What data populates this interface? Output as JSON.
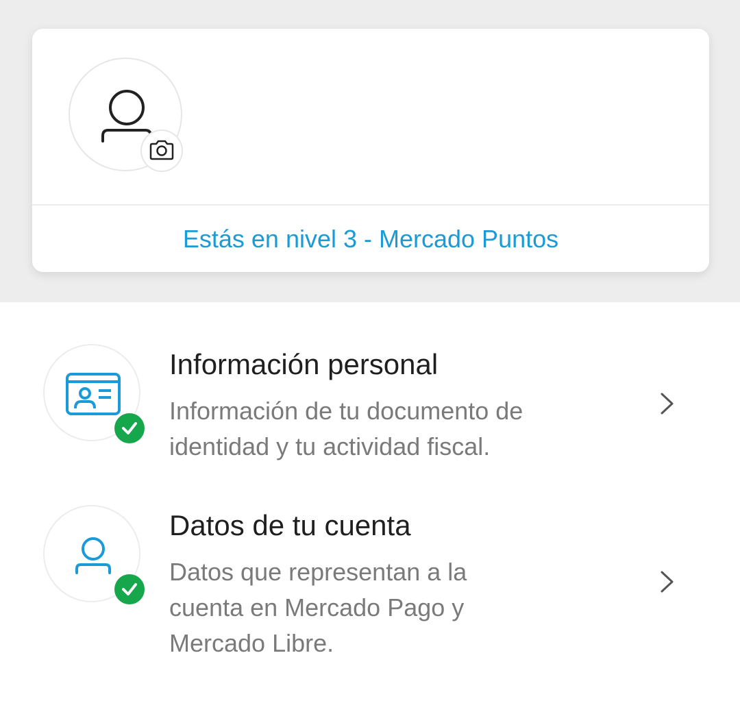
{
  "profile": {
    "level_link": "Estás en nivel 3 - Mercado Puntos",
    "avatar_icon": "person-icon",
    "camera_icon": "camera-icon"
  },
  "rows": [
    {
      "title": "Información personal",
      "description": "Información de tu documento de identidad y tu actividad fiscal.",
      "icon": "id-card-icon",
      "status_icon": "check-icon",
      "chevron": "chevron-right-icon"
    },
    {
      "title": "Datos de tu cuenta",
      "description": "Datos que representan a la cuenta en Mercado Pago y Mercado Libre.",
      "icon": "user-icon",
      "status_icon": "check-icon",
      "chevron": "chevron-right-icon"
    }
  ],
  "colors": {
    "accent": "#1a9ad6",
    "success": "#16a64b",
    "background_top": "#ededed"
  }
}
